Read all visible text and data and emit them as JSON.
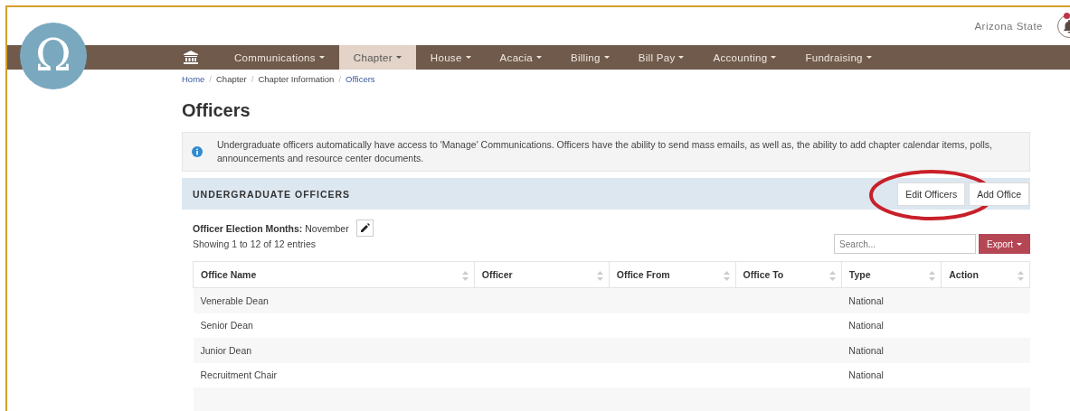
{
  "logo": "Ω",
  "header": {
    "school": "Arizona State",
    "notifications": {
      "has_unread": true
    }
  },
  "nav": [
    {
      "label": "Communications",
      "selected": false
    },
    {
      "label": "Chapter",
      "selected": true
    },
    {
      "label": "House",
      "selected": false
    },
    {
      "label": "Acacia",
      "selected": false
    },
    {
      "label": "Billing",
      "selected": false
    },
    {
      "label": "Bill Pay",
      "selected": false
    },
    {
      "label": "Accounting",
      "selected": false
    },
    {
      "label": "Fundraising",
      "selected": false
    }
  ],
  "breadcrumb_separator": "/",
  "breadcrumb": [
    {
      "label": "Home",
      "link": true
    },
    {
      "label": "Chapter",
      "link": false
    },
    {
      "label": "Chapter Information",
      "link": false
    },
    {
      "label": "Officers",
      "link": true
    }
  ],
  "page_title": "Officers",
  "info": "Undergraduate officers automatically have access to 'Manage' Communications. Officers have the ability to send mass emails, as well as, the ability to add chapter calendar items, polls, announcements and resource center documents.",
  "panel": {
    "title": "UNDERGRADUATE OFFICERS",
    "buttons": [
      {
        "label": "Edit Officers",
        "circled": true
      },
      {
        "label": "Add Office",
        "circled": false
      }
    ]
  },
  "election": {
    "label": "Officer Election Months:",
    "value": "November"
  },
  "entries": "Showing 1 to 12 of 12 entries",
  "search": {
    "placeholder": "Search..."
  },
  "export": "Export",
  "table": {
    "columns": [
      "Office Name",
      "Officer",
      "Office From",
      "Office To",
      "Type",
      "Action"
    ],
    "rows": [
      [
        "Venerable Dean",
        "",
        "",
        "",
        "National",
        ""
      ],
      [
        "Senior Dean",
        "",
        "",
        "",
        "National",
        ""
      ],
      [
        "Junior Dean",
        "",
        "",
        "",
        "National",
        ""
      ],
      [
        "Recruitment Chair",
        "",
        "",
        "",
        "National",
        ""
      ]
    ]
  }
}
